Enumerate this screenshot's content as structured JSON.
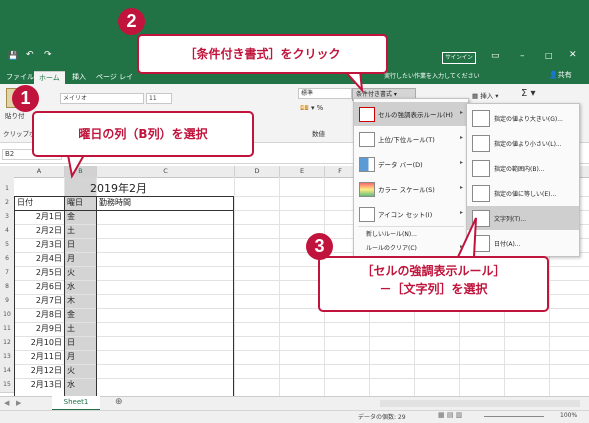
{
  "qat": {
    "save_glyph": "💾",
    "undo_glyph": "↶",
    "redo_glyph": "↷"
  },
  "window": {
    "signin": "サインイン",
    "share": "共有",
    "tellme": "実行したい作業を入力してください"
  },
  "tabs": [
    "ファイル",
    "ホーム",
    "挿入",
    "ページ レイ"
  ],
  "ribbon": {
    "paste": "貼り付",
    "clipboard": "クリップボ",
    "font_name": "メイリオ",
    "font_size": "11",
    "number_format": "標準",
    "number_group": "数値",
    "conditional_formatting": "条件付き書式",
    "insert": "挿入",
    "sum": "Σ"
  },
  "formula_bar": {
    "name_box": "B2"
  },
  "columns": [
    "A",
    "B",
    "C",
    "D",
    "E",
    "F",
    "G",
    "H",
    "I"
  ],
  "rows": [
    "1",
    "2",
    "3",
    "4",
    "5",
    "6",
    "7",
    "8",
    "9",
    "10",
    "11",
    "12",
    "13",
    "14",
    "15"
  ],
  "sheet": {
    "title": "2019年2月",
    "headers": [
      "日付",
      "曜日",
      "勤務時間"
    ],
    "dates": [
      "2月1日",
      "2月2日",
      "2月3日",
      "2月4日",
      "2月5日",
      "2月6日",
      "2月7日",
      "2月8日",
      "2月9日",
      "2月10日",
      "2月11日",
      "2月12日",
      "2月13日"
    ],
    "weekdays": [
      "金",
      "土",
      "日",
      "月",
      "火",
      "水",
      "木",
      "金",
      "土",
      "日",
      "月",
      "火",
      "水"
    ]
  },
  "cf_menu": [
    {
      "label": "セルの強調表示ルール(H)",
      "arrow": "▸"
    },
    {
      "label": "上位/下位ルール(T)",
      "arrow": "▸"
    },
    {
      "label": "データ バー(D)",
      "arrow": "▸"
    },
    {
      "label": "カラー スケール(S)",
      "arrow": "▸"
    },
    {
      "label": "アイコン セット(I)",
      "arrow": "▸"
    },
    {
      "label": "新しいルール(N)...",
      "arrow": ""
    },
    {
      "label": "ルールのクリア(C)",
      "arrow": "▸"
    }
  ],
  "highlight_submenu": [
    "指定の値より大きい(G)...",
    "指定の値より小さい(L)...",
    "指定の範囲内(B)...",
    "指定の値に等しい(E)...",
    "文字列(T)...",
    "日付(A)..."
  ],
  "sheet_tabs": {
    "active": "Sheet1",
    "add": "⊕"
  },
  "status": {
    "count": "データの個数: 29",
    "zoom": "100%"
  },
  "callouts": {
    "step1_num": "1",
    "step1_text": "曜日の列（B列）を選択",
    "step2_num": "2",
    "step2_text": "［条件付き書式］をクリック",
    "step3_num": "3",
    "step3_line1": "［セルの強調表示ルール］",
    "step3_line2": "－［文字列］を選択"
  },
  "colors": {
    "excel_green": "#217346",
    "callout_red": "#c0143c"
  }
}
